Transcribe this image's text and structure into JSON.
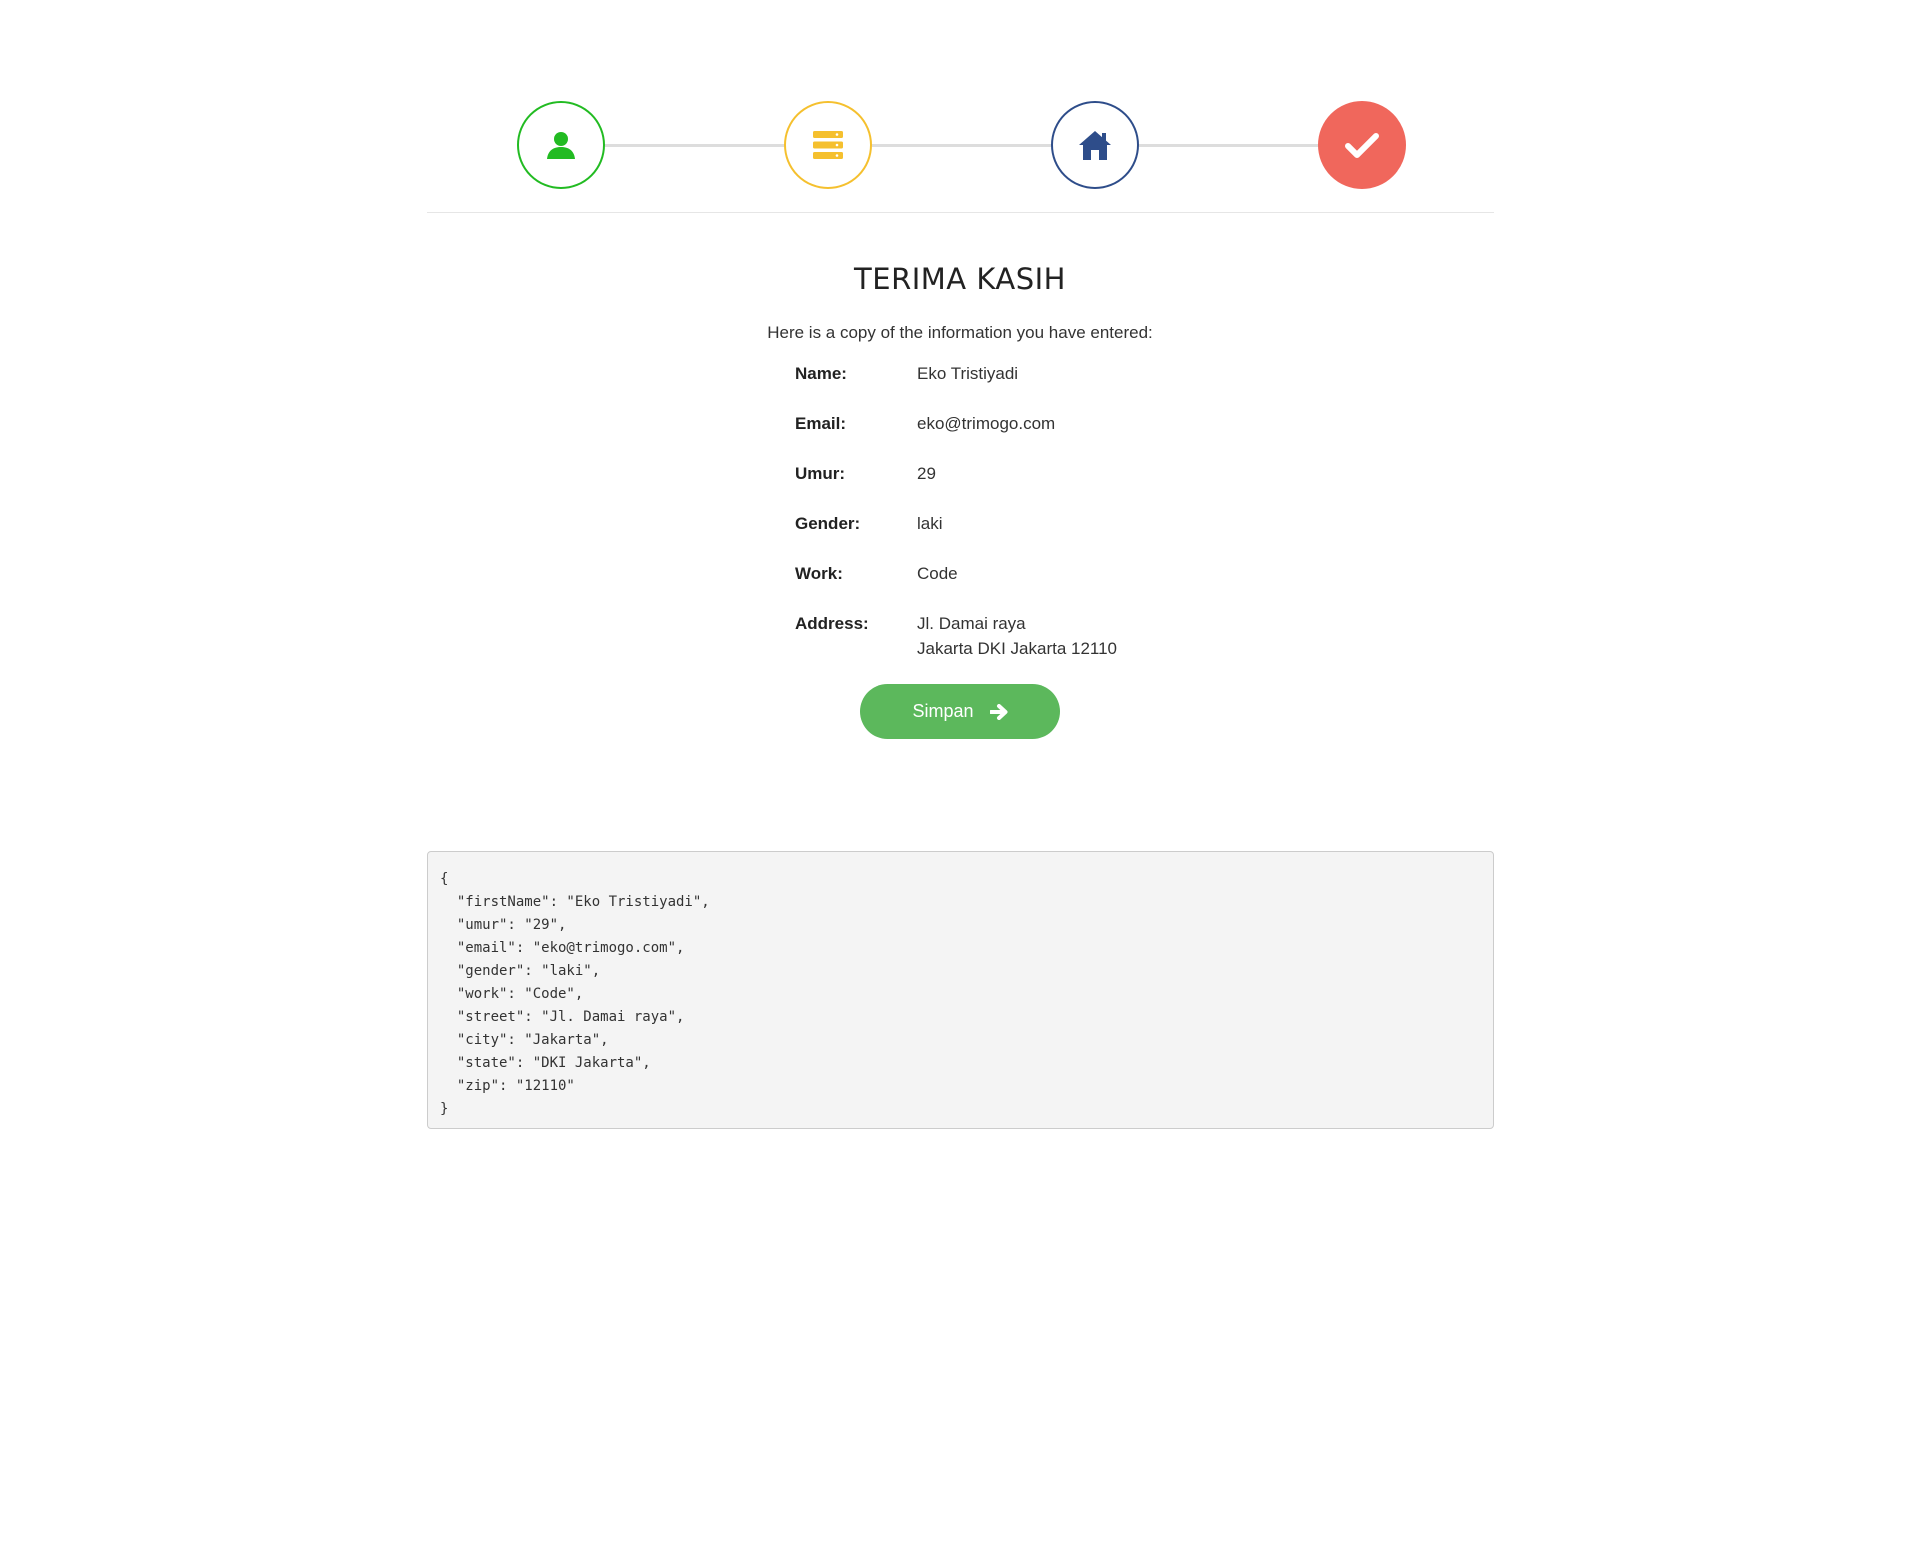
{
  "wizard": {
    "steps": [
      {
        "icon": "user-icon",
        "color": "#22bb22"
      },
      {
        "icon": "server-icon",
        "color": "#f5c02e"
      },
      {
        "icon": "home-icon",
        "color": "#2e4d8a"
      },
      {
        "icon": "check-icon",
        "color": "#f0675c"
      }
    ]
  },
  "thanks": {
    "title": "TERIMA KASIH",
    "intro": "Here is a copy of the information you have entered:"
  },
  "info": {
    "name_label": "Name:",
    "name_value": "Eko Tristiyadi",
    "email_label": "Email:",
    "email_value": "eko@trimogo.com",
    "umur_label": "Umur:",
    "umur_value": "29",
    "gender_label": "Gender:",
    "gender_value": "laki",
    "work_label": "Work:",
    "work_value": "Code",
    "address_label": "Address:",
    "address_line1": "Jl. Damai raya",
    "address_line2": "Jakarta DKI Jakarta 12110"
  },
  "button": {
    "label": "Simpan",
    "color": "#5cb85c"
  },
  "json_output": {
    "text": "{\n  \"firstName\": \"Eko Tristiyadi\",\n  \"umur\": \"29\",\n  \"email\": \"eko@trimogo.com\",\n  \"gender\": \"laki\",\n  \"work\": \"Code\",\n  \"street\": \"Jl. Damai raya\",\n  \"city\": \"Jakarta\",\n  \"state\": \"DKI Jakarta\",\n  \"zip\": \"12110\"\n}"
  }
}
